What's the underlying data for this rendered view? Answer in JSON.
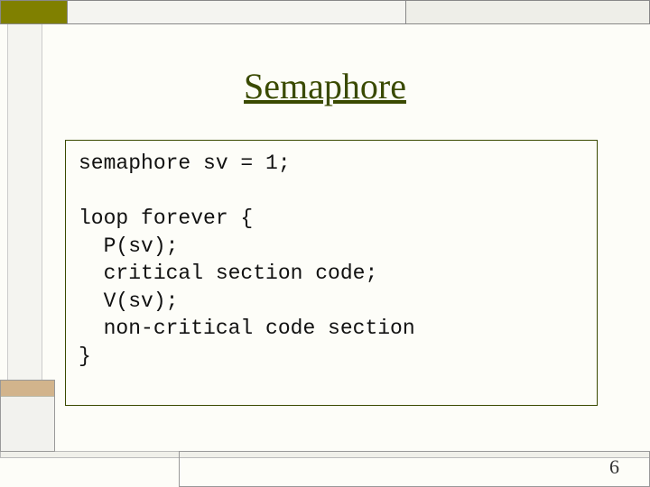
{
  "title": "Semaphore",
  "code_lines": [
    "semaphore sv = 1;",
    "",
    "loop forever {",
    "  P(sv);",
    "  critical section code;",
    "  V(sv);",
    "  non-critical code section",
    "}"
  ],
  "page_number": "6",
  "colors": {
    "olive": "#808000",
    "tan": "#d2b48c",
    "title_color": "#3a4a00",
    "code_border": "#3a4a00"
  }
}
